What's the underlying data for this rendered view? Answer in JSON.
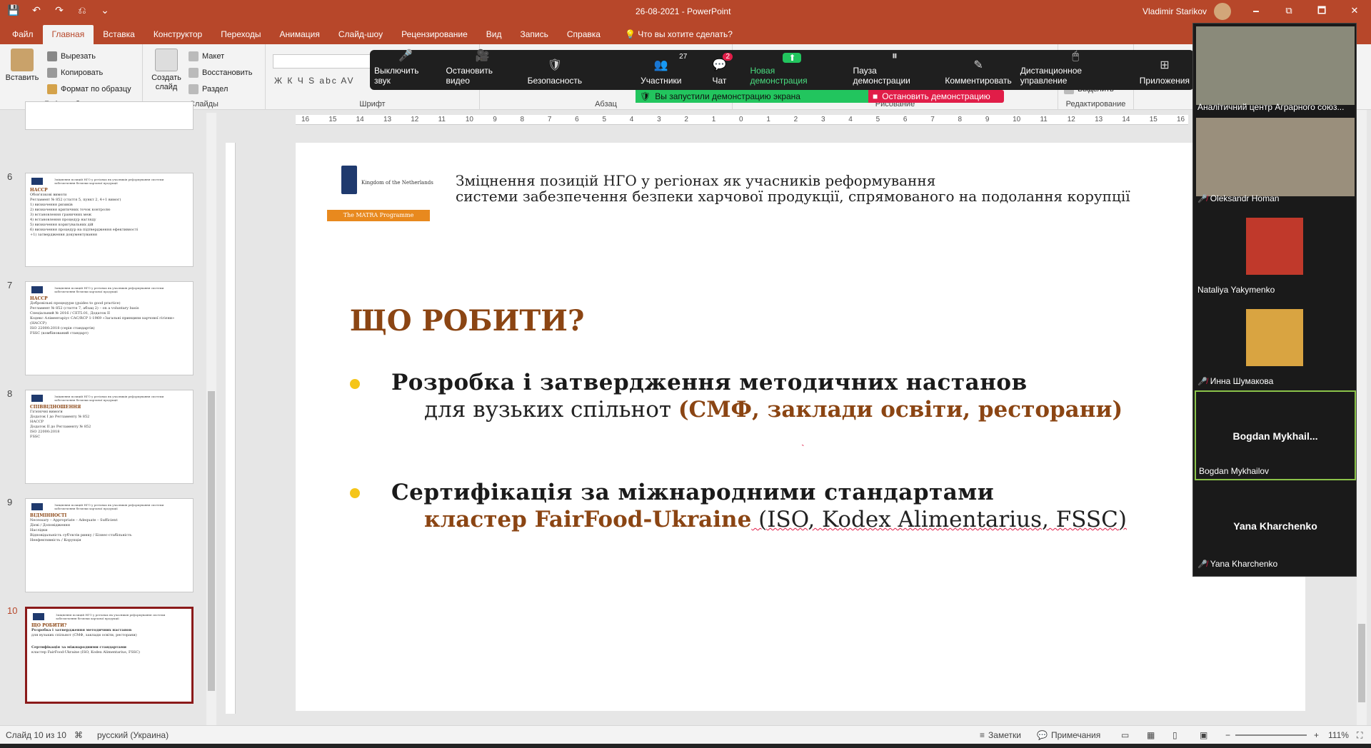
{
  "window": {
    "title": "26-08-2021  -  PowerPoint",
    "user": "Vladimir Starikov",
    "controls": [
      "🗕",
      "⧉",
      "🗖",
      "✕"
    ]
  },
  "qat": [
    "💾",
    "↶",
    "↷",
    "⎌",
    "⌄"
  ],
  "tabs": [
    {
      "label": "Файл",
      "active": false
    },
    {
      "label": "Главная",
      "active": true
    },
    {
      "label": "Вставка",
      "active": false
    },
    {
      "label": "Конструктор",
      "active": false
    },
    {
      "label": "Переходы",
      "active": false
    },
    {
      "label": "Анимация",
      "active": false
    },
    {
      "label": "Слайд-шоу",
      "active": false
    },
    {
      "label": "Рецензирование",
      "active": false
    },
    {
      "label": "Вид",
      "active": false
    },
    {
      "label": "Запись",
      "active": false
    },
    {
      "label": "Справка",
      "active": false
    }
  ],
  "tell_me": "Что вы хотите сделать?",
  "ribbon": {
    "clipboard": {
      "label": "Буфер обмена",
      "paste": "Вставить",
      "cut": "Вырезать",
      "copy": "Копировать",
      "format": "Формат по образцу"
    },
    "slides": {
      "label": "Слайды",
      "create": "Создать слайд",
      "layout": "Макет",
      "reset": "Восстановить",
      "section": "Раздел"
    },
    "font": {
      "label": "Шрифт",
      "format_glyphs": "Ж  К  Ч  S  abc  AV"
    },
    "paragraph": {
      "label": "Абзац"
    },
    "drawing": {
      "label": "Рисование"
    },
    "editing": {
      "label": "Редактирование",
      "select": "Выделить"
    }
  },
  "zoom": {
    "items": [
      {
        "label": "Выключить звук",
        "icon": "🎤"
      },
      {
        "label": "Остановить видео",
        "icon": "🎥"
      },
      {
        "label": "Безопасность",
        "icon": "🛡"
      },
      {
        "label": "Участники",
        "icon": "👥",
        "badge": "27"
      },
      {
        "label": "Чат",
        "icon": "💬",
        "badge": "2"
      },
      {
        "label": "Новая демонстрация",
        "icon": "⬆"
      },
      {
        "label": "Пауза демонстрации",
        "icon": "⏸"
      },
      {
        "label": "Комментировать",
        "icon": "✎"
      },
      {
        "label": "Дистанционное управление",
        "icon": "🖱"
      },
      {
        "label": "Приложения",
        "icon": "⊞"
      }
    ],
    "share_status": "Вы запустили демонстрацию экрана",
    "stop_share": "Остановить демонстрацию"
  },
  "thumbnails": [
    {
      "num": "6",
      "title": "НАССР",
      "text": [
        "Обов'язкові вимоги",
        "Регламент № 852 (стаття 5, пункт 2, 4+1 вимог)",
        "1) визначення ризиків",
        "2) визначення критичних точок контролю",
        "3) встановлення граничних меж",
        "4) встановлення процедур нагляду",
        "5) визначення коригувальних дій",
        "6) визначення процедур на підтвердження ефективності",
        "+1) затвердження документування"
      ],
      "active": false
    },
    {
      "num": "7",
      "title": "НАССР",
      "text": [
        "Добровільні процедури (guides to good practice)",
        "Регламент № 852 (стаття 7, абзац 2) – on a voluntary basis",
        "Спеціальний № 2016 / СЕТ5.01, Додаток II",
        "Кодекс Аліментаріус CAC/RCP 1-1969 «Загальні принципи харчової гігієни» (НАССР)",
        "ISO 22000:2018 (серія стандартів)",
        "FSSC (комбінований стандарт)"
      ],
      "active": false
    },
    {
      "num": "8",
      "title": "СПІВВІДНОШЕННЯ",
      "text": [
        "Гігієнічні вимоги",
        "НАССР",
        "Додаток I до Регламенту № 852",
        "Додаток II до Регламенту № 852",
        "ISO 22000:2018",
        "FSSC"
      ],
      "active": false
    },
    {
      "num": "9",
      "title": "ВІДМІННОСТІ",
      "text": [
        "Necessary – Appropriate – Adequate – Sufficient",
        "Дієві / Доповідження",
        "Наслідки",
        "Відповідальність суб'єктів ринку / Бізнес-стабільність",
        "Неефективність / Корупція"
      ],
      "active": false
    },
    {
      "num": "10",
      "title": "ЩО РОБИТИ?",
      "text": [
        "Розробка і затвердження методичних настанов",
        "для вузьких спільнот (СМФ, заклади освіти, ресторани)",
        "Сертифікація за міжнародними стандартами",
        "кластер FairFood-Ukraine (ISO, Kodex Alimentarius, FSSC)"
      ],
      "active": true
    }
  ],
  "thumb_header": "Зміцнення позицій НГО у регіонах як учасників реформування системи забезпечення безпеки харчової продукції",
  "ruler_labels": [
    "16",
    "15",
    "14",
    "13",
    "12",
    "11",
    "10",
    "9",
    "8",
    "7",
    "6",
    "5",
    "4",
    "3",
    "2",
    "1",
    "0",
    "1",
    "2",
    "3",
    "4",
    "5",
    "6",
    "7",
    "8",
    "9",
    "10",
    "11",
    "12",
    "13",
    "14",
    "15",
    "16"
  ],
  "slide": {
    "logo_text": "Kingdom of the Netherlands",
    "matra": "The MATRA Programme",
    "header_line1": "Зміцнення позицій НГО у регіонах як учасників реформування",
    "header_line2": "системи забезпечення безпеки харчової продукції, спрямованого на подолання корупції",
    "title": "ЩО РОБИТИ?",
    "bullet1_line1": "Розробка і затвердження методичних настанов",
    "bullet1_line2_plain": "для вузьких спільнот ",
    "bullet1_line2_accent": "(СМФ, заклади освіти, ресторани)",
    "bullet2_line1": "Сертифікація за міжнародними стандартами",
    "bullet2_line2_accent": "кластер FairFood-Ukraine",
    "bullet2_line2_plain": " (ISO, Kodex Alimentarius, FSSC)"
  },
  "participants": [
    {
      "name": "Аналітичний центр Аграрного союз...",
      "video": true,
      "muted": false,
      "active": false
    },
    {
      "name": "Oleksandr Homan",
      "video": true,
      "muted": true,
      "active": false
    },
    {
      "name": "Nataliya Yakymenko",
      "video": false,
      "avatar": true,
      "muted": false,
      "active": false
    },
    {
      "name": "Инна Шумакова",
      "video": false,
      "avatar": true,
      "muted": true,
      "active": false
    },
    {
      "name": "Bogdan Mykhailov",
      "center": "Bogdan  Mykhail...",
      "muted": false,
      "active": true
    },
    {
      "name": "Yana Kharchenko",
      "center": "Yana Kharchenko",
      "muted": true,
      "active": false
    }
  ],
  "status": {
    "slide_info": "Слайд 10 из 10",
    "language": "русский (Украина)",
    "notes": "Заметки",
    "comments": "Примечания",
    "zoom": "111%"
  },
  "colors": {
    "accent": "#b7472a",
    "title_brown": "#8b4513",
    "bullet": "#f5c518",
    "zoom_green": "#22c55e",
    "zoom_red": "#e11d48"
  }
}
